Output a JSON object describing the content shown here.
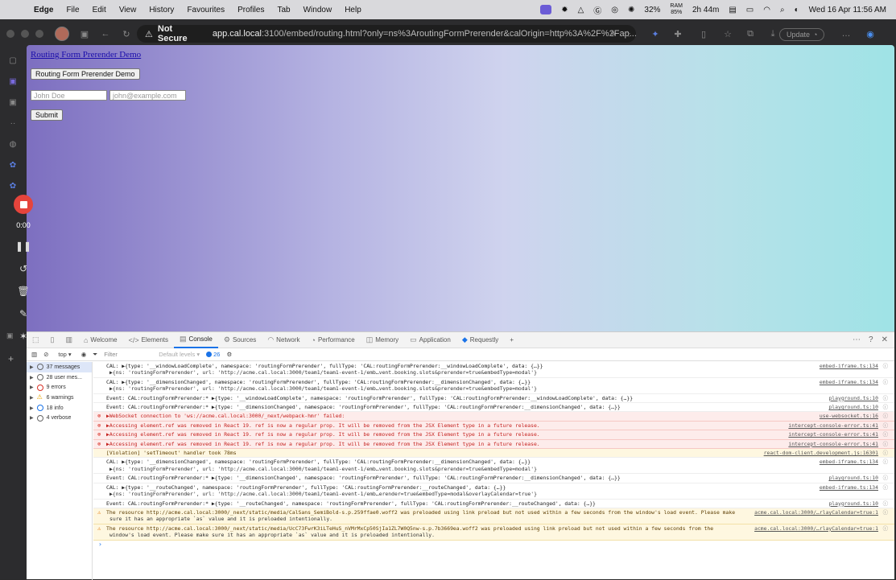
{
  "menubar": {
    "app": "Edge",
    "items": [
      "File",
      "Edit",
      "View",
      "History",
      "Favourites",
      "Profiles",
      "Tab",
      "Window",
      "Help"
    ],
    "battery_pct": "32%",
    "ram_label": "RAM",
    "ram_pct": "85%",
    "time_left": "2h 44m",
    "datetime": "Wed 16 Apr  11:56 AM"
  },
  "browser": {
    "not_secure": "Not Secure",
    "url_host": "app.cal.local",
    "url_rest": ":3100/embed/routing.html?only=ns%3AroutingFormPrerender&calOrigin=http%3A%2F%2Fap...",
    "update_label": "Update"
  },
  "page": {
    "link_title": "Routing Form Prerender Demo",
    "demo_button": "Routing Form Prerender Demo",
    "name_placeholder": "John Doe",
    "email_placeholder": "john@example.com",
    "submit_label": "Submit"
  },
  "recorder": {
    "time": "0:00"
  },
  "devtools": {
    "tabs": [
      {
        "label": "Welcome",
        "icon": "home-icon"
      },
      {
        "label": "Elements",
        "icon": "code-icon"
      },
      {
        "label": "Console",
        "icon": "console-icon"
      },
      {
        "label": "Sources",
        "icon": "sources-icon"
      },
      {
        "label": "Network",
        "icon": "wifi-icon"
      },
      {
        "label": "Performance",
        "icon": "performance-icon"
      },
      {
        "label": "Memory",
        "icon": "memory-icon"
      },
      {
        "label": "Application",
        "icon": "application-icon"
      },
      {
        "label": "Requestly",
        "icon": "requestly-icon"
      }
    ],
    "active_tab": "Console",
    "context": "top",
    "filter_placeholder": "Filter",
    "levels": "Default levels",
    "issue_count": "26",
    "sidebar": [
      {
        "label": "37 messages",
        "icon": "messages-icon"
      },
      {
        "label": "28 user mes...",
        "icon": "user-icon"
      },
      {
        "label": "9 errors",
        "icon": "error-icon"
      },
      {
        "label": "6 warnings",
        "icon": "warning-icon"
      },
      {
        "label": "18 info",
        "icon": "info-icon"
      },
      {
        "label": "4 verbose",
        "icon": "verbose-icon"
      }
    ],
    "rows": [
      {
        "level": "log",
        "text": "CAL:  ▶{type: '__windowLoadComplete', namespace: 'routingFormPrerender', fullType: 'CAL:routingFormPrerender:__windowLoadComplete', data: {…}}",
        "sub": "▶{ns: 'routingFormPrerender', url: 'http://acme.cal.local:3000/team1/team1-event-1/emb…vent.booking.slots&prerender=true&embedType=modal'}",
        "src": "embed-iframe.ts:134"
      },
      {
        "level": "log",
        "text": "CAL:  ▶{type: '__dimensionChanged', namespace: 'routingFormPrerender', fullType: 'CAL:routingFormPrerender:__dimensionChanged', data: {…}}",
        "sub": "▶{ns: 'routingFormPrerender', url: 'http://acme.cal.local:3000/team1/team1-event-1/emb…vent.booking.slots&prerender=true&embedType=modal'}",
        "src": "embed-iframe.ts:134"
      },
      {
        "level": "log",
        "text": "Event:  CAL:routingFormPrerender:*  ▶{type: '__windowLoadComplete', namespace: 'routingFormPrerender', fullType: 'CAL:routingFormPrerender:__windowLoadComplete', data: {…}}",
        "sub": "",
        "src": "playground.ts:10"
      },
      {
        "level": "log",
        "text": "Event:  CAL:routingFormPrerender:*  ▶{type: '__dimensionChanged', namespace: 'routingFormPrerender', fullType: 'CAL:routingFormPrerender:__dimensionChanged', data: {…}}",
        "sub": "",
        "src": "playground.ts:10"
      },
      {
        "level": "error",
        "text": "▶WebSocket connection to 'ws://acme.cal.local:3000/_next/webpack-hmr' failed:",
        "sub": "",
        "src": "use-websocket.ts:16"
      },
      {
        "level": "error",
        "text": "▶Accessing element.ref was removed in React 19. ref is now a regular prop. It will be removed from the JSX Element type in a future release.",
        "sub": "",
        "src": "intercept-console-error.ts:41"
      },
      {
        "level": "error",
        "text": "▶Accessing element.ref was removed in React 19. ref is now a regular prop. It will be removed from the JSX Element type in a future release.",
        "sub": "",
        "src": "intercept-console-error.ts:41"
      },
      {
        "level": "error",
        "text": "▶Accessing element.ref was removed in React 19. ref is now a regular prop. It will be removed from the JSX Element type in a future release.",
        "sub": "",
        "src": "intercept-console-error.ts:41"
      },
      {
        "level": "violation",
        "text": "[Violation] 'setTimeout' handler took 78ms",
        "sub": "",
        "src": "react-dom-client.development.js:16301"
      },
      {
        "level": "log",
        "text": "CAL:  ▶{type: '__dimensionChanged', namespace: 'routingFormPrerender', fullType: 'CAL:routingFormPrerender:__dimensionChanged', data: {…}}",
        "sub": "▶{ns: 'routingFormPrerender', url: 'http://acme.cal.local:3000/team1/team1-event-1/emb…vent.booking.slots&prerender=true&embedType=modal'}",
        "src": "embed-iframe.ts:134"
      },
      {
        "level": "log",
        "text": "Event:  CAL:routingFormPrerender:*  ▶{type: '__dimensionChanged', namespace: 'routingFormPrerender', fullType: 'CAL:routingFormPrerender:__dimensionChanged', data: {…}}",
        "sub": "",
        "src": "playground.ts:10"
      },
      {
        "level": "log",
        "text": "CAL:  ▶{type: '__routeChanged', namespace: 'routingFormPrerender', fullType: 'CAL:routingFormPrerender:__routeChanged', data: {…}}",
        "sub": "▶{ns: 'routingFormPrerender', url: 'http://acme.cal.local:3000/team1/team1-event-1/emb…erender=true&embedType=modal&overlayCalendar=true'}",
        "src": "embed-iframe.ts:134"
      },
      {
        "level": "log",
        "text": "Event:  CAL:routingFormPrerender:*  ▶{type: '__routeChanged', namespace: 'routingFormPrerender', fullType: 'CAL:routingFormPrerender:__routeChanged', data: {…}}",
        "sub": "",
        "src": "playground.ts:10"
      },
      {
        "level": "warning",
        "text": "The resource http://acme.cal.local:3000/_next/static/media/CalSans_SemiBold-s.p.259ffae0.woff2 was preloaded using link preload but not used within a few seconds from the window's load event. Please make",
        "sub": "sure it has an appropriate `as` value and it is preloaded intentionally.",
        "src": "acme.cal.local:3000/…rlayCalendar=true:1"
      },
      {
        "level": "warning",
        "text": "The resource http://acme.cal.local:3000/_next/static/media/UcC73FwrK3iLTeHuS_nVMrMxCp50SjIa1ZL7W0Q5nw-s.p.7b3669ea.woff2 was preloaded using link preload but not used within a few seconds from the",
        "sub": "window's load event. Please make sure it has an appropriate `as` value and it is preloaded intentionally.",
        "src": "acme.cal.local:3000/…rlayCalendar=true:1"
      }
    ]
  },
  "colors": {
    "accent": "#1a73e8",
    "record": "#e5443c",
    "error_bg": "#fdeceb",
    "warning_bg": "#fef7e0"
  }
}
